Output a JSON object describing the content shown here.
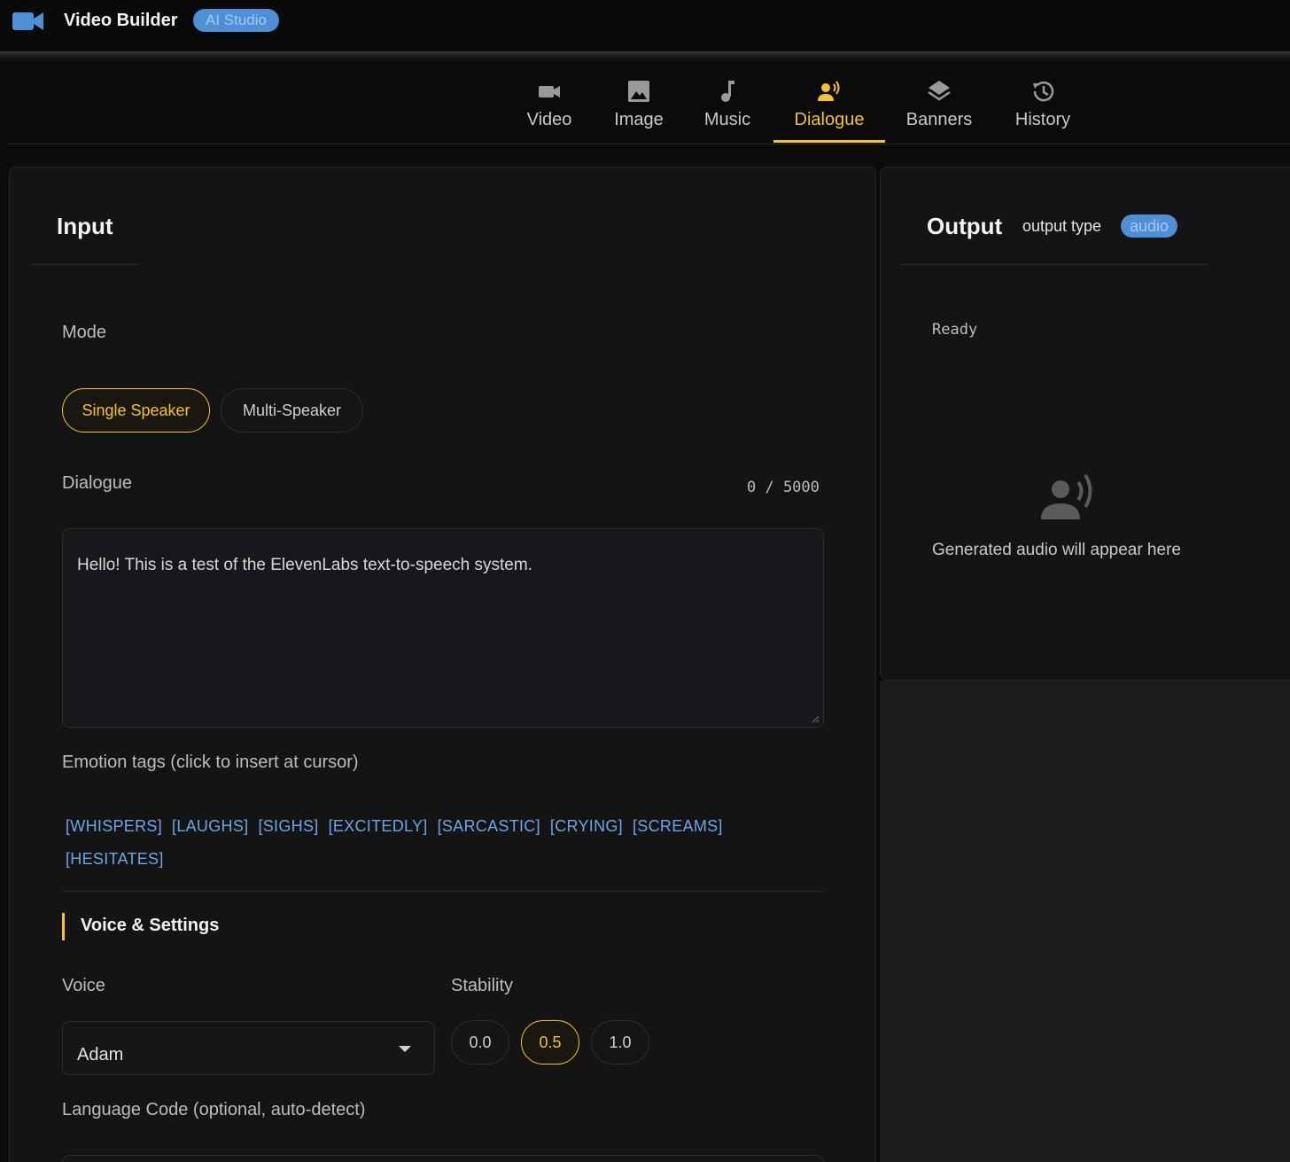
{
  "app": {
    "title": "Video Builder",
    "badge": "AI Studio"
  },
  "tabs": [
    {
      "label": "Video",
      "icon": "video-camera-icon"
    },
    {
      "label": "Image",
      "icon": "image-icon"
    },
    {
      "label": "Music",
      "icon": "music-note-icon"
    },
    {
      "label": "Dialogue",
      "icon": "speaker-voice-icon",
      "active": true
    },
    {
      "label": "Banners",
      "icon": "layers-icon"
    },
    {
      "label": "History",
      "icon": "history-icon"
    }
  ],
  "input": {
    "title": "Input",
    "mode_label": "Mode",
    "modes": [
      {
        "label": "Single Speaker",
        "active": true
      },
      {
        "label": "Multi-Speaker",
        "active": false
      }
    ],
    "dialogue_label": "Dialogue",
    "counter": "0 / 5000",
    "dialogue_text": "Hello! This is a test of the ElevenLabs text-to-speech system.",
    "emotion_label": "Emotion tags (click to insert at cursor)",
    "emotion_tags": [
      "[WHISPERS]",
      "[LAUGHS]",
      "[SIGHS]",
      "[EXCITEDLY]",
      "[SARCASTIC]",
      "[CRYING]",
      "[SCREAMS]",
      "[HESITATES]"
    ],
    "section_title": "Voice & Settings",
    "voice_label": "Voice",
    "voice_value": "Adam",
    "stability_label": "Stability",
    "stability_options": [
      {
        "label": "0.0",
        "active": false
      },
      {
        "label": "0.5",
        "active": true
      },
      {
        "label": "1.0",
        "active": false
      }
    ],
    "language_label": "Language Code (optional, auto-detect)"
  },
  "output": {
    "title": "Output",
    "type_label": "output type",
    "type_value": "audio",
    "status": "Ready",
    "placeholder": "Generated audio will appear here"
  },
  "colors": {
    "accent": "#f4c22f",
    "badge": "#4f8fd6",
    "tag": "#6aa6e8"
  }
}
